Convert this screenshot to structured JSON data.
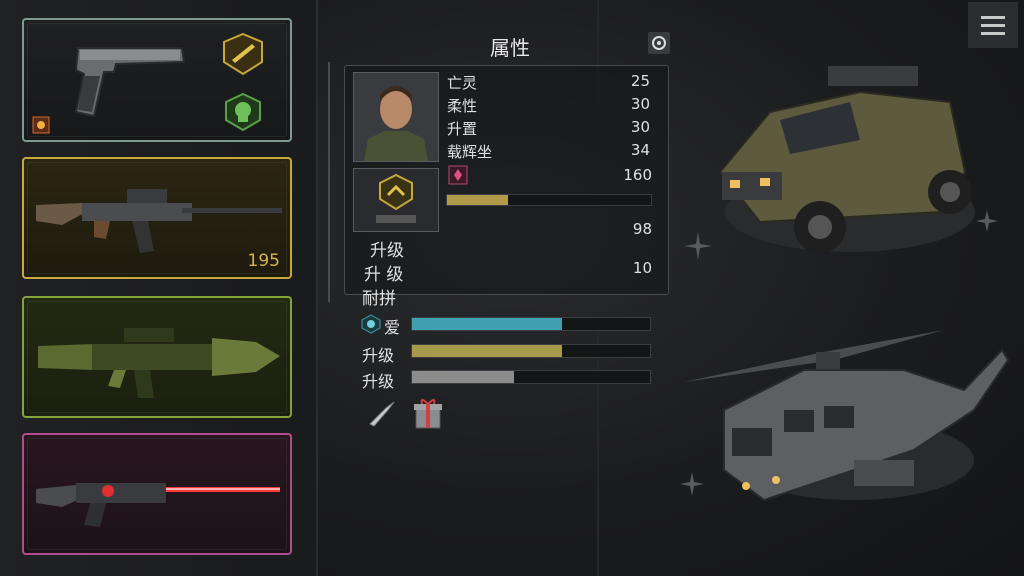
{
  "header": {
    "title": "属性",
    "settings_icon": "settings-icon",
    "menu_icon": "hamburger-menu-icon"
  },
  "weapons": [
    {
      "name": "pistol",
      "icon": "pistol-icon",
      "badges": [
        "gold-weapon-badge",
        "green-skull-badge",
        "small-rank-badge"
      ],
      "ammo": ""
    },
    {
      "name": "assault-rifle",
      "icon": "rifle-icon",
      "badges": [],
      "ammo": "195"
    },
    {
      "name": "rocket-launcher",
      "icon": "rpg-icon",
      "badges": [],
      "ammo": ""
    },
    {
      "name": "laser-rifle",
      "icon": "laser-rifle-icon",
      "badges": [],
      "ammo": ""
    }
  ],
  "stats_panel": {
    "stats": [
      {
        "label": "亡灵",
        "value": "25"
      },
      {
        "label": "柔性",
        "value": "30"
      },
      {
        "label": "升置",
        "value": "30"
      },
      {
        "label": "载辉坐",
        "value": "34"
      }
    ],
    "power_value": "160",
    "power_progress": 0.3,
    "values": [
      "98",
      "10"
    ],
    "labels": [
      "升级",
      "升 级",
      "耐拼"
    ]
  },
  "lower_bars": [
    {
      "label": "爱",
      "progress": 0.63,
      "color": "#3fa0b0"
    },
    {
      "label": "升级",
      "progress": 0.63,
      "color": "#a89a4c"
    },
    {
      "label": "升级",
      "progress": 0.43,
      "color": "#8c8c8c"
    }
  ],
  "items": [
    "bullet-icon",
    "gift-box-icon"
  ],
  "vehicles": [
    "armored-truck",
    "helicopter"
  ],
  "colors": {
    "gold": "#c7a83a",
    "green": "#86a23a",
    "pink": "#b04c8a",
    "teal_border": "#7d9b8c"
  }
}
